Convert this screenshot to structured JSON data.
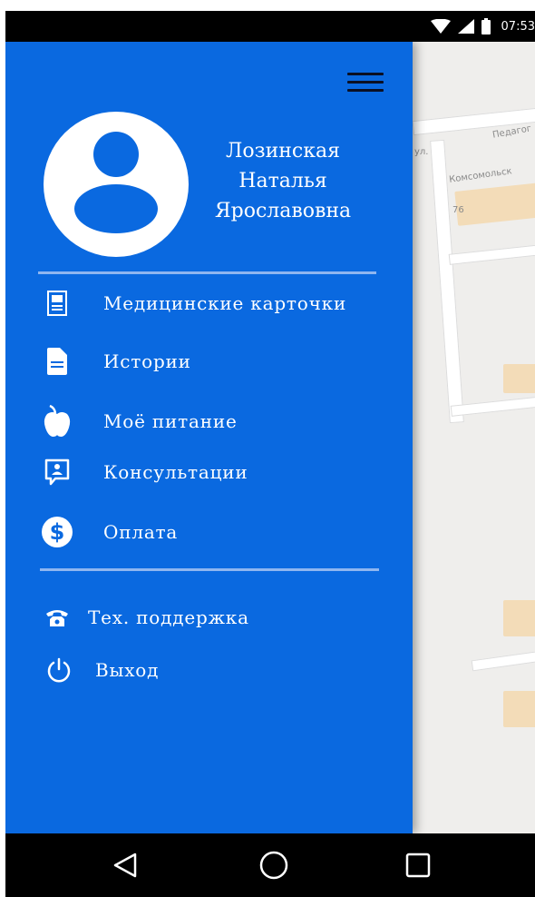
{
  "status_bar": {
    "time": "07:53",
    "icons": [
      "wifi-icon",
      "cell-signal-icon",
      "battery-icon"
    ]
  },
  "map": {
    "labels": [
      "Педагог",
      "ул.",
      "Комсомольск",
      "76"
    ]
  },
  "drawer": {
    "background_color": "#0a69e0",
    "user": {
      "name_line1": "Лозинская",
      "name_line2": "Наталья",
      "name_line3": "Ярославовна"
    },
    "menu": [
      {
        "icon": "medical-card-icon",
        "label": "Медицинские карточки"
      },
      {
        "icon": "document-icon",
        "label": "Истории"
      },
      {
        "icon": "apple-icon",
        "label": "Моё питание"
      },
      {
        "icon": "consultation-chat-icon",
        "label": "Консультации"
      },
      {
        "icon": "dollar-icon",
        "label": "Оплата"
      }
    ],
    "secondary": [
      {
        "icon": "phone-icon",
        "label": "Тех. поддержка"
      },
      {
        "icon": "power-icon",
        "label": "Выход"
      }
    ]
  },
  "nav_bar": {
    "buttons": [
      "back-icon",
      "home-icon",
      "recents-icon"
    ]
  }
}
